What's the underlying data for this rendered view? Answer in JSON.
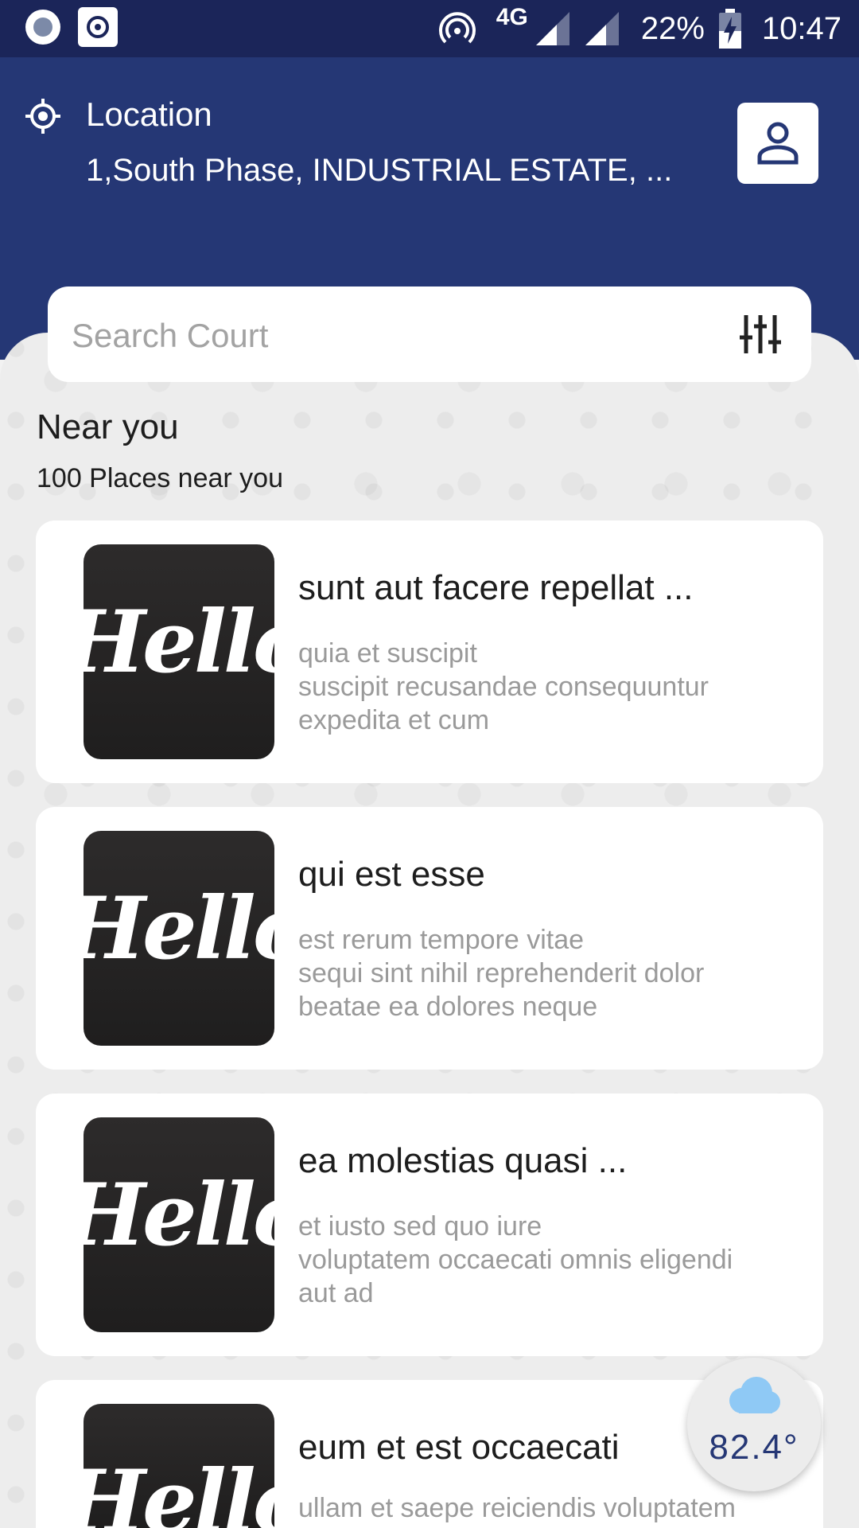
{
  "status_bar": {
    "network": "4G",
    "battery": "22%",
    "time": "10:47"
  },
  "header": {
    "location_label": "Location",
    "address": "1,South Phase, INDUSTRIAL ESTATE, ..."
  },
  "search": {
    "placeholder": "Search Court"
  },
  "section": {
    "title": "Near you",
    "subtitle": "100 Places near you"
  },
  "places": [
    {
      "image_text": "Hello!",
      "title": "sunt aut facere repellat ...",
      "body": "quia et suscipit\nsuscipit recusandae consequuntur\nexpedita et cum"
    },
    {
      "image_text": "Hello!",
      "title": "qui est esse",
      "body": "est rerum tempore vitae\nsequi sint nihil reprehenderit dolor\nbeatae ea dolores neque"
    },
    {
      "image_text": "Hello!",
      "title": "ea molestias quasi ...",
      "body": "et iusto sed quo iure\nvoluptatem occaecati omnis eligendi\naut ad"
    },
    {
      "image_text": "Hello!",
      "title": "eum et est occaecati",
      "body": "ullam et saepe reiciendis voluptatem"
    }
  ],
  "weather": {
    "temperature": "82.4°"
  },
  "colors": {
    "status_bar": "#1b2559",
    "header": "#253775",
    "accent": "#253775",
    "cloud": "#8fc9f5"
  }
}
